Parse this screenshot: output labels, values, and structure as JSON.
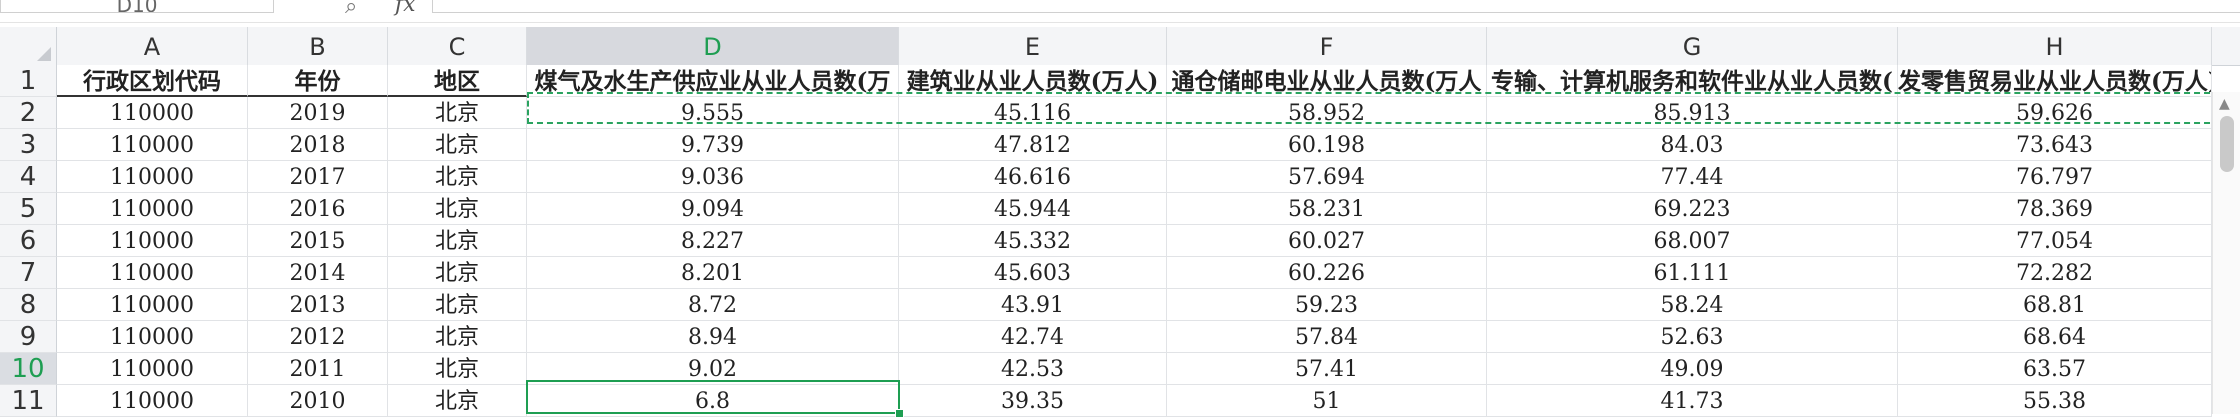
{
  "formula_bar": {
    "name_box": "D10",
    "zoom_icon": "zoom-icon",
    "fx_label": "fx",
    "formula": ""
  },
  "columns": [
    {
      "letter": "A"
    },
    {
      "letter": "B"
    },
    {
      "letter": "C"
    },
    {
      "letter": "D"
    },
    {
      "letter": "E"
    },
    {
      "letter": "F"
    },
    {
      "letter": "G"
    },
    {
      "letter": "H"
    }
  ],
  "selected_column": "D",
  "rows": [
    {
      "num": "1",
      "cells": [
        "行政区划代码",
        "年份",
        "地区",
        "煤气及水生产供应业从业人员数(万",
        "建筑业从业人员数(万人)",
        "通仓储邮电业从业人员数(万人",
        "专输、计算机服务和软件业从业人员数(",
        "发零售贸易业从业人员数(万人)"
      ]
    },
    {
      "num": "2",
      "cells": [
        "110000",
        "2019",
        "北京",
        "9.555",
        "45.116",
        "58.952",
        "85.913",
        "59.626"
      ]
    },
    {
      "num": "3",
      "cells": [
        "110000",
        "2018",
        "北京",
        "9.739",
        "47.812",
        "60.198",
        "84.03",
        "73.643"
      ]
    },
    {
      "num": "4",
      "cells": [
        "110000",
        "2017",
        "北京",
        "9.036",
        "46.616",
        "57.694",
        "77.44",
        "76.797"
      ]
    },
    {
      "num": "5",
      "cells": [
        "110000",
        "2016",
        "北京",
        "9.094",
        "45.944",
        "58.231",
        "69.223",
        "78.369"
      ]
    },
    {
      "num": "6",
      "cells": [
        "110000",
        "2015",
        "北京",
        "8.227",
        "45.332",
        "60.027",
        "68.007",
        "77.054"
      ]
    },
    {
      "num": "7",
      "cells": [
        "110000",
        "2014",
        "北京",
        "8.201",
        "45.603",
        "60.226",
        "61.111",
        "72.282"
      ]
    },
    {
      "num": "8",
      "cells": [
        "110000",
        "2013",
        "北京",
        "8.72",
        "43.91",
        "59.23",
        "58.24",
        "68.81"
      ]
    },
    {
      "num": "9",
      "cells": [
        "110000",
        "2012",
        "北京",
        "8.94",
        "42.74",
        "57.84",
        "52.63",
        "68.64"
      ]
    },
    {
      "num": "10",
      "cells": [
        "110000",
        "2011",
        "北京",
        "9.02",
        "42.53",
        "57.41",
        "49.09",
        "63.57"
      ]
    },
    {
      "num": "11",
      "cells": [
        "110000",
        "2010",
        "北京",
        "6.8",
        "39.35",
        "51",
        "41.73",
        "55.38"
      ]
    }
  ],
  "selected_row": "10",
  "colors": {
    "selection": "#1e9e52",
    "header_bg": "#f4f5f7"
  }
}
